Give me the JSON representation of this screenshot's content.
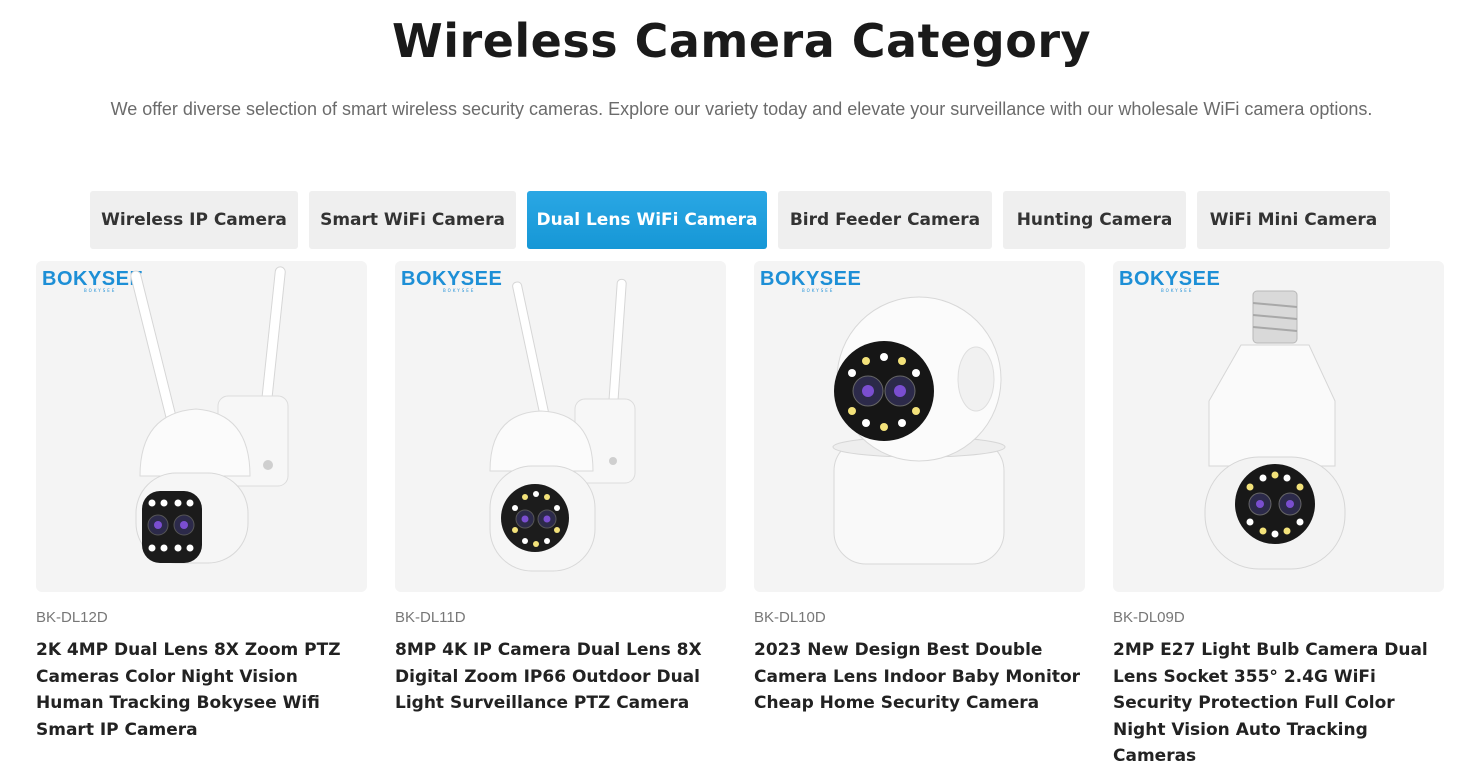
{
  "section": {
    "title": "Wireless Camera Category",
    "subtitle": "We offer diverse selection of smart wireless security cameras. Explore our variety today and elevate your surveillance with our wholesale WiFi camera options."
  },
  "tabs": [
    {
      "label": "Wireless IP Camera",
      "active": false
    },
    {
      "label": "Smart WiFi Camera",
      "active": false
    },
    {
      "label": "Dual Lens WiFi Camera",
      "active": true
    },
    {
      "label": "Bird Feeder Camera",
      "active": false
    },
    {
      "label": "Hunting Camera",
      "active": false
    },
    {
      "label": "WiFi Mini Camera",
      "active": false
    }
  ],
  "brand": {
    "logo": "BOKYSEE",
    "logo_sub": "BOKYSEE"
  },
  "colors": {
    "accent": "#1d9bdb",
    "tab_bg": "#efefef",
    "card_bg": "#f4f4f4",
    "brand": "#1d8fd6"
  },
  "products": [
    {
      "sku": "BK-DL12D",
      "name": "2K 4MP Dual Lens 8X Zoom PTZ Cameras Color Night Vision Human Tracking Bokysee Wifi Smart IP Camera",
      "icon": "outdoor-ptz-camera-image"
    },
    {
      "sku": "BK-DL11D",
      "name": "8MP 4K IP Camera Dual Lens 8X Digital Zoom IP66 Outdoor Dual Light Surveillance PTZ Camera",
      "icon": "outdoor-ptz-camera-image"
    },
    {
      "sku": "BK-DL10D",
      "name": "2023 New Design Best Double Camera Lens Indoor Baby Monitor Cheap Home Security Camera",
      "icon": "indoor-pan-tilt-camera-image"
    },
    {
      "sku": "BK-DL09D",
      "name": "2MP E27 Light Bulb Camera Dual Lens Socket 355° 2.4G WiFi Security Protection Full Color Night Vision Auto Tracking Cameras",
      "icon": "light-bulb-camera-image"
    }
  ]
}
